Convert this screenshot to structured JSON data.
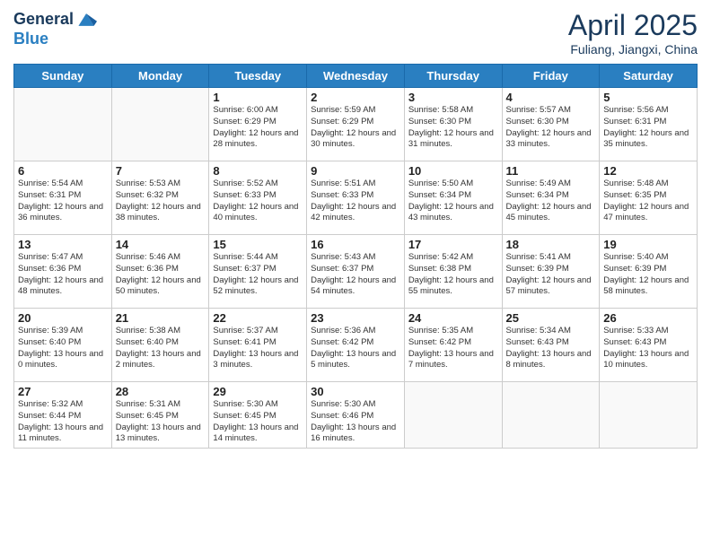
{
  "logo": {
    "general": "General",
    "blue": "Blue"
  },
  "header": {
    "title": "April 2025",
    "subtitle": "Fuliang, Jiangxi, China"
  },
  "weekdays": [
    "Sunday",
    "Monday",
    "Tuesday",
    "Wednesday",
    "Thursday",
    "Friday",
    "Saturday"
  ],
  "weeks": [
    [
      {
        "day": "",
        "info": ""
      },
      {
        "day": "",
        "info": ""
      },
      {
        "day": "1",
        "info": "Sunrise: 6:00 AM\nSunset: 6:29 PM\nDaylight: 12 hours and 28 minutes."
      },
      {
        "day": "2",
        "info": "Sunrise: 5:59 AM\nSunset: 6:29 PM\nDaylight: 12 hours and 30 minutes."
      },
      {
        "day": "3",
        "info": "Sunrise: 5:58 AM\nSunset: 6:30 PM\nDaylight: 12 hours and 31 minutes."
      },
      {
        "day": "4",
        "info": "Sunrise: 5:57 AM\nSunset: 6:30 PM\nDaylight: 12 hours and 33 minutes."
      },
      {
        "day": "5",
        "info": "Sunrise: 5:56 AM\nSunset: 6:31 PM\nDaylight: 12 hours and 35 minutes."
      }
    ],
    [
      {
        "day": "6",
        "info": "Sunrise: 5:54 AM\nSunset: 6:31 PM\nDaylight: 12 hours and 36 minutes."
      },
      {
        "day": "7",
        "info": "Sunrise: 5:53 AM\nSunset: 6:32 PM\nDaylight: 12 hours and 38 minutes."
      },
      {
        "day": "8",
        "info": "Sunrise: 5:52 AM\nSunset: 6:33 PM\nDaylight: 12 hours and 40 minutes."
      },
      {
        "day": "9",
        "info": "Sunrise: 5:51 AM\nSunset: 6:33 PM\nDaylight: 12 hours and 42 minutes."
      },
      {
        "day": "10",
        "info": "Sunrise: 5:50 AM\nSunset: 6:34 PM\nDaylight: 12 hours and 43 minutes."
      },
      {
        "day": "11",
        "info": "Sunrise: 5:49 AM\nSunset: 6:34 PM\nDaylight: 12 hours and 45 minutes."
      },
      {
        "day": "12",
        "info": "Sunrise: 5:48 AM\nSunset: 6:35 PM\nDaylight: 12 hours and 47 minutes."
      }
    ],
    [
      {
        "day": "13",
        "info": "Sunrise: 5:47 AM\nSunset: 6:36 PM\nDaylight: 12 hours and 48 minutes."
      },
      {
        "day": "14",
        "info": "Sunrise: 5:46 AM\nSunset: 6:36 PM\nDaylight: 12 hours and 50 minutes."
      },
      {
        "day": "15",
        "info": "Sunrise: 5:44 AM\nSunset: 6:37 PM\nDaylight: 12 hours and 52 minutes."
      },
      {
        "day": "16",
        "info": "Sunrise: 5:43 AM\nSunset: 6:37 PM\nDaylight: 12 hours and 54 minutes."
      },
      {
        "day": "17",
        "info": "Sunrise: 5:42 AM\nSunset: 6:38 PM\nDaylight: 12 hours and 55 minutes."
      },
      {
        "day": "18",
        "info": "Sunrise: 5:41 AM\nSunset: 6:39 PM\nDaylight: 12 hours and 57 minutes."
      },
      {
        "day": "19",
        "info": "Sunrise: 5:40 AM\nSunset: 6:39 PM\nDaylight: 12 hours and 58 minutes."
      }
    ],
    [
      {
        "day": "20",
        "info": "Sunrise: 5:39 AM\nSunset: 6:40 PM\nDaylight: 13 hours and 0 minutes."
      },
      {
        "day": "21",
        "info": "Sunrise: 5:38 AM\nSunset: 6:40 PM\nDaylight: 13 hours and 2 minutes."
      },
      {
        "day": "22",
        "info": "Sunrise: 5:37 AM\nSunset: 6:41 PM\nDaylight: 13 hours and 3 minutes."
      },
      {
        "day": "23",
        "info": "Sunrise: 5:36 AM\nSunset: 6:42 PM\nDaylight: 13 hours and 5 minutes."
      },
      {
        "day": "24",
        "info": "Sunrise: 5:35 AM\nSunset: 6:42 PM\nDaylight: 13 hours and 7 minutes."
      },
      {
        "day": "25",
        "info": "Sunrise: 5:34 AM\nSunset: 6:43 PM\nDaylight: 13 hours and 8 minutes."
      },
      {
        "day": "26",
        "info": "Sunrise: 5:33 AM\nSunset: 6:43 PM\nDaylight: 13 hours and 10 minutes."
      }
    ],
    [
      {
        "day": "27",
        "info": "Sunrise: 5:32 AM\nSunset: 6:44 PM\nDaylight: 13 hours and 11 minutes."
      },
      {
        "day": "28",
        "info": "Sunrise: 5:31 AM\nSunset: 6:45 PM\nDaylight: 13 hours and 13 minutes."
      },
      {
        "day": "29",
        "info": "Sunrise: 5:30 AM\nSunset: 6:45 PM\nDaylight: 13 hours and 14 minutes."
      },
      {
        "day": "30",
        "info": "Sunrise: 5:30 AM\nSunset: 6:46 PM\nDaylight: 13 hours and 16 minutes."
      },
      {
        "day": "",
        "info": ""
      },
      {
        "day": "",
        "info": ""
      },
      {
        "day": "",
        "info": ""
      }
    ]
  ]
}
